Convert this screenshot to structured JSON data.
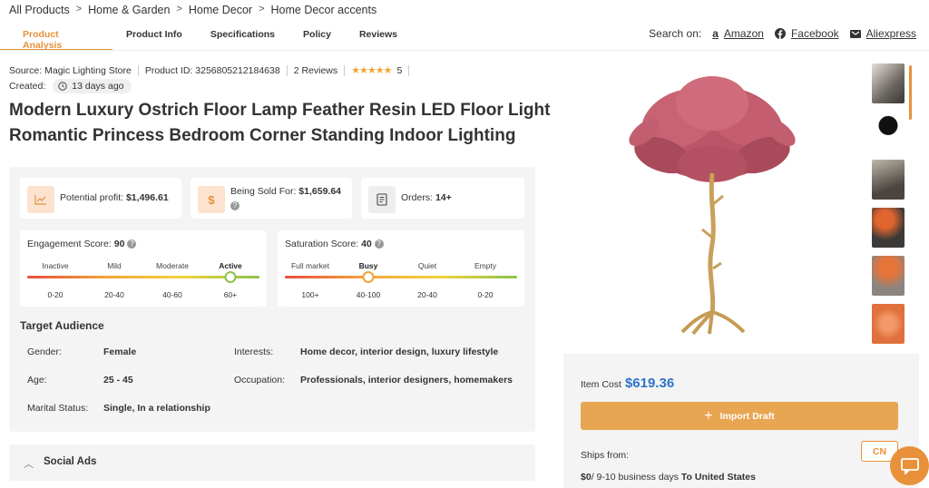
{
  "breadcrumb": [
    "All Products",
    "Home & Garden",
    "Home Decor",
    "Home Decor accents"
  ],
  "tabs": [
    {
      "label": "Product Analysis",
      "active": true
    },
    {
      "label": "Product Info"
    },
    {
      "label": "Specifications"
    },
    {
      "label": "Policy"
    },
    {
      "label": "Reviews"
    }
  ],
  "search_on": {
    "label": "Search on:",
    "sites": [
      {
        "name": "Amazon",
        "icon": "amazon-icon"
      },
      {
        "name": "Facebook",
        "icon": "facebook-icon"
      },
      {
        "name": "Aliexpress",
        "icon": "aliexpress-icon"
      }
    ]
  },
  "meta": {
    "source": "Source: Magic Lighting Store",
    "product_id": "Product ID: 3256805212184638",
    "reviews": "2 Reviews",
    "rating": "5",
    "created_label": "Created:",
    "created_value": "13 days ago"
  },
  "title_line1": "Modern Luxury Ostrich Floor Lamp Feather Resin LED Floor Light",
  "title_line2": "Romantic Princess Bedroom Corner Standing Indoor Lighting",
  "stats": {
    "profit_label": "Potential profit:",
    "profit_value": "$1,496.61",
    "sold_label": "Being Sold For:",
    "sold_value": "$1,659.64",
    "orders_label": "Orders:",
    "orders_value": "14+",
    "dollar_glyph": "$"
  },
  "engagement": {
    "label": "Engagement Score:",
    "value": "90",
    "levels": [
      "Inactive",
      "Mild",
      "Moderate",
      "Active"
    ],
    "ranges": [
      "0-20",
      "20-40",
      "40-60",
      "60+"
    ],
    "active_index": 3
  },
  "saturation": {
    "label": "Saturation Score:",
    "value": "40",
    "levels": [
      "Full market",
      "Busy",
      "Quiet",
      "Empty"
    ],
    "ranges": [
      "100+",
      "40-100",
      "20-40",
      "0-20"
    ],
    "active_index": 1
  },
  "audience": {
    "title": "Target Audience",
    "gender_label": "Gender:",
    "gender": "Female",
    "age_label": "Age:",
    "age": "25 - 45",
    "marital_label": "Marital Status:",
    "marital": "Single, In a relationship",
    "interests_label": "Interests:",
    "interests": "Home decor, interior design, luxury lifestyle",
    "occupation_label": "Occupation:",
    "occupation": "Professionals, interior designers, homemakers"
  },
  "social_ads": "Social Ads",
  "buy": {
    "cost_label": "Item Cost",
    "cost_value": "$619.36",
    "import_label": "Import Draft",
    "ships_from": "Ships from:",
    "country": "CN",
    "ship_price": "$0",
    "ship_days": "/ 9-10 business days",
    "ship_to": "To United States"
  },
  "colors": {
    "accent": "#e8913a",
    "price_blue": "#2e73c8",
    "feather_pink": "#c15c6c",
    "gold": "#c9a05a"
  }
}
